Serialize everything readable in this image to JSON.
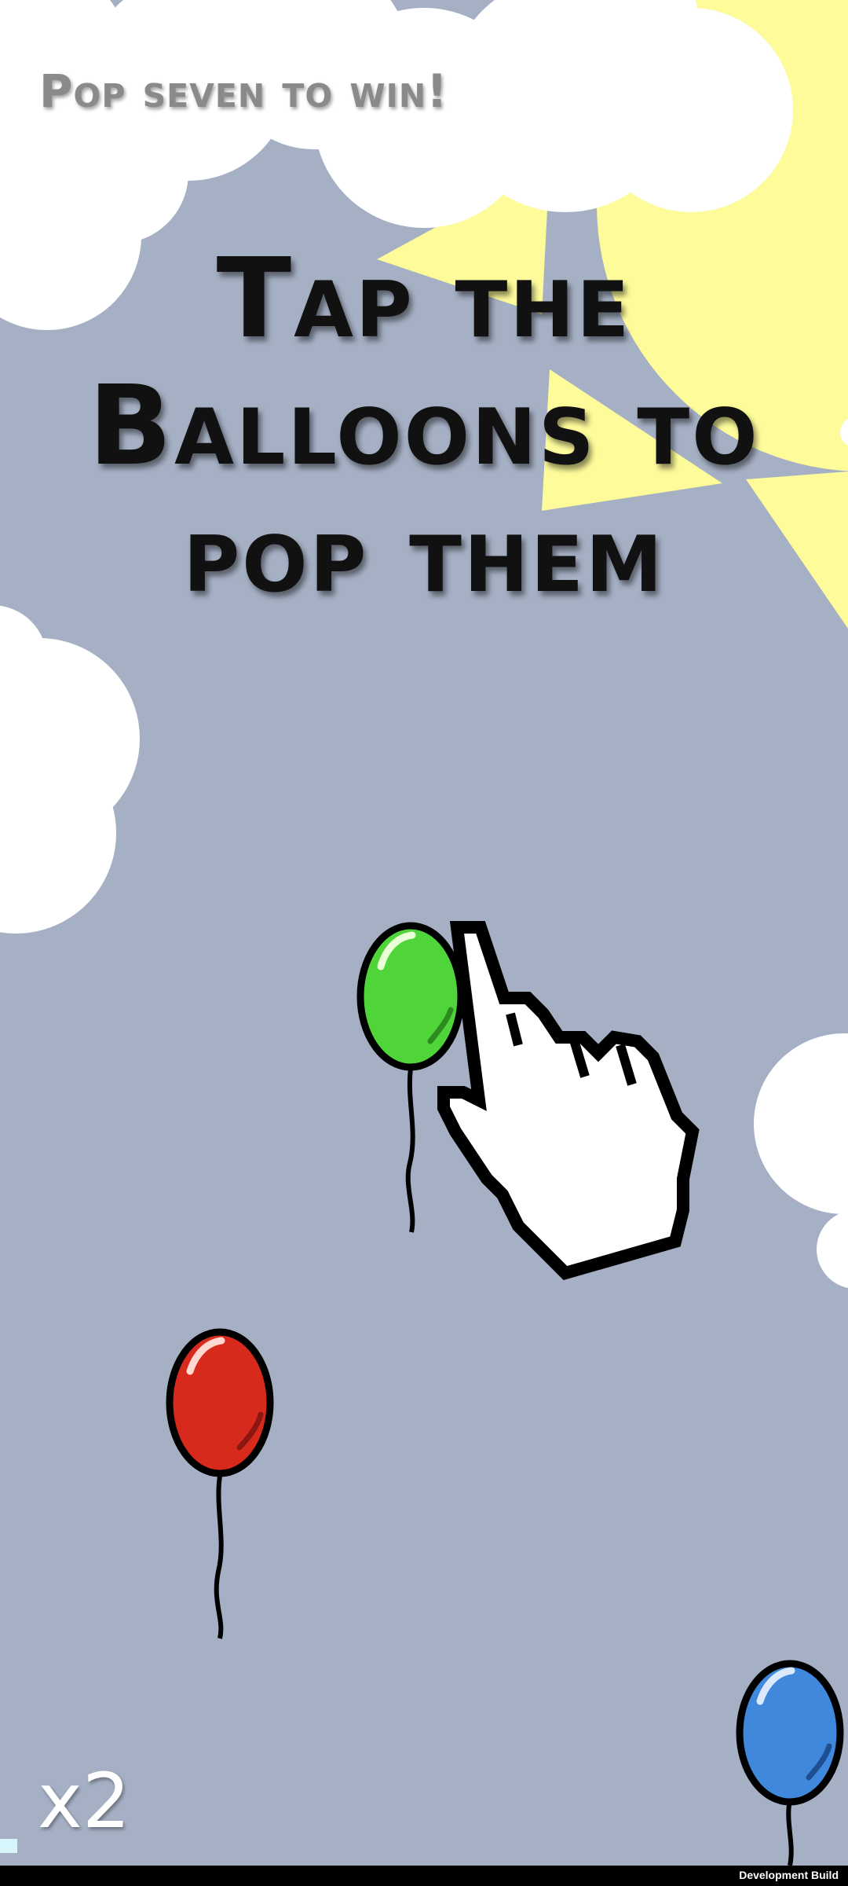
{
  "hud": {
    "goal_text": "Pop seven to win!",
    "multiplier": "x2"
  },
  "tutorial": {
    "lines": [
      "Tap the",
      "Balloons to",
      "pop them"
    ]
  },
  "balloons": [
    {
      "color": "green",
      "fill": "#4fd43a"
    },
    {
      "color": "red",
      "fill": "#d8291d"
    },
    {
      "color": "blue",
      "fill": "#3f88dc"
    }
  ],
  "footer": {
    "build_label": "Development Build"
  },
  "colors": {
    "sky": "#a5b0c4",
    "sun": "#fdfb9a",
    "cloud": "#ffffff"
  },
  "icons": {
    "pointer": "hand-pointer-icon"
  }
}
